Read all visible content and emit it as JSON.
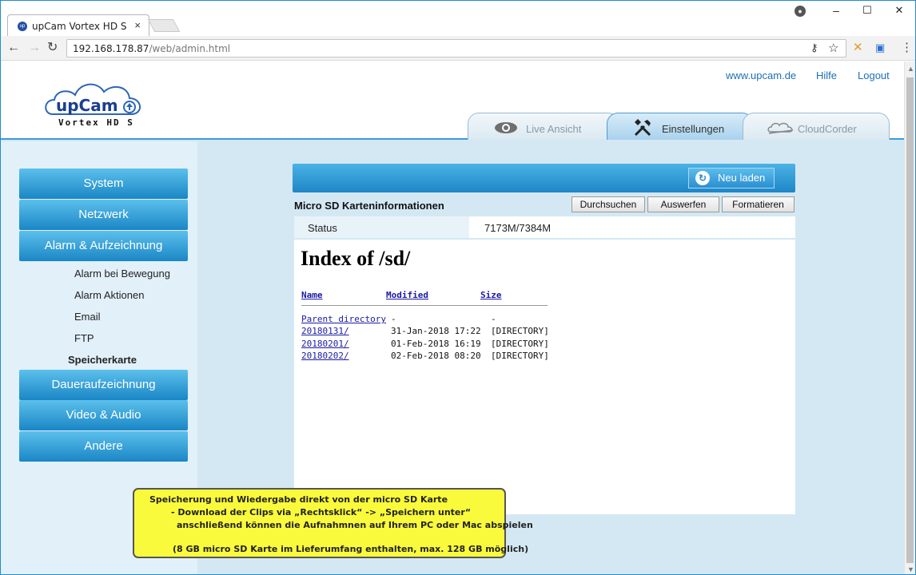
{
  "browser": {
    "tab_title": "upCam Vortex HD S",
    "tab_close": "×",
    "url_host": "192.168.178.87",
    "url_path": "/web/admin.html",
    "win_minimize": "–",
    "win_maximize": "☐",
    "win_close": "✕",
    "icons": [
      "favicon-icon",
      "user-icon",
      "back-icon",
      "forward-icon",
      "reload-icon",
      "key-icon",
      "star-icon",
      "extension-x-icon",
      "extension-cast-icon",
      "menu-icon"
    ]
  },
  "header": {
    "logo_text": "upCam",
    "logo_subtitle": "Vortex HD S",
    "links": {
      "website": "www.upcam.de",
      "help": "Hilfe",
      "logout": "Logout"
    },
    "tabs": [
      {
        "label": "Live Ansicht",
        "icon": "eye-icon",
        "active": false
      },
      {
        "label": "Einstellungen",
        "icon": "tools-icon",
        "active": true
      },
      {
        "label": "CloudCorder",
        "icon": "cloudcorder-icon",
        "active": false
      }
    ]
  },
  "sidebar": {
    "system": "System",
    "network": "Netzwerk",
    "alarm": "Alarm & Aufzeichnung",
    "sub_items": [
      "Alarm bei Bewegung",
      "Alarm Aktionen",
      "Email",
      "FTP",
      "Speicherkarte"
    ],
    "continuous": "Daueraufzeichnung",
    "video_audio": "Video & Audio",
    "other": "Andere"
  },
  "main": {
    "reload_label": "Neu laden",
    "sd_title": "Micro SD Karteninformationen",
    "buttons": {
      "browse": "Durchsuchen",
      "eject": "Auswerfen",
      "format": "Formatieren"
    },
    "status_label": "Status",
    "status_value": "7173M/7384M",
    "index_title": "Index of /sd/",
    "columns": {
      "name": "Name",
      "modified": "Modified",
      "size": "Size"
    },
    "rows": [
      {
        "name": "Parent directory",
        "modified": "-",
        "size": "-"
      },
      {
        "name": "20180131/",
        "modified": "31-Jan-2018 17:22",
        "size": "[DIRECTORY]"
      },
      {
        "name": "20180201/",
        "modified": "01-Feb-2018 16:19",
        "size": "[DIRECTORY]"
      },
      {
        "name": "20180202/",
        "modified": "02-Feb-2018 08:20",
        "size": "[DIRECTORY]"
      }
    ]
  },
  "note": {
    "line1": "Speicherung und Wiedergabe direkt von der micro SD Karte",
    "line2": "- Download der Clips via „Rechtsklick“ -> „Speichern unter“",
    "line3": "anschließend können die Aufnahmnen auf Ihrem PC oder Mac abspielen",
    "line4": "(8 GB micro SD Karte im Lieferumfang enthalten, max. 128 GB möglich)"
  },
  "colors": {
    "accent": "#1f86c7",
    "note_bg": "#fafa3c",
    "link": "#1e6fb6"
  }
}
